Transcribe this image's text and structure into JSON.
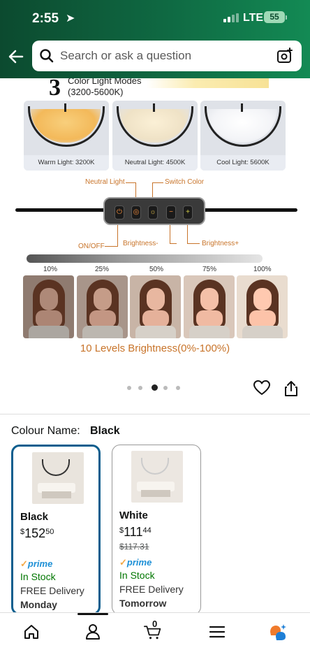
{
  "status_bar": {
    "time": "2:55",
    "network": "LTE",
    "battery": "55"
  },
  "search": {
    "placeholder": "Search or ask a question"
  },
  "hero": {
    "modes_number": "3",
    "modes_title": "Color Light Modes",
    "modes_range": "(3200-5600K)",
    "lamp_cards": [
      {
        "label": "Warm Light: 3200K",
        "glow": "#f6c56a"
      },
      {
        "label": "Neutral Light: 4500K",
        "glow": "#f5e6c2"
      },
      {
        "label": "Cool Light: 5600K",
        "glow": "#ffffff"
      }
    ],
    "controller_labels": {
      "neutral": "Neutral Light",
      "switch": "Switch Color",
      "onoff": "ON/OFF",
      "bminus": "Brightness-",
      "bplus": "Brightness+"
    },
    "percentages": [
      "10%",
      "25%",
      "50%",
      "75%",
      "100%"
    ],
    "caption": "10 Levels Brightness(0%-100%)"
  },
  "carousel": {
    "count": 5,
    "active_index": 2
  },
  "colour": {
    "label": "Colour Name:",
    "value": "Black",
    "options": [
      {
        "name": "Black",
        "currency": "$",
        "price_whole": "152",
        "price_frac": "50",
        "prime": "prime",
        "stock": "In Stock",
        "delivery": "FREE Delivery",
        "when": "Monday",
        "selected": true
      },
      {
        "name": "White",
        "currency": "$",
        "price_whole": "111",
        "price_frac": "44",
        "old_price": "$117.31",
        "prime": "prime",
        "stock": "In Stock",
        "delivery": "FREE Delivery",
        "when": "Tomorrow",
        "selected": false
      }
    ]
  },
  "nav": {
    "cart_count": "0",
    "items": [
      "home-icon",
      "account-icon",
      "cart-icon",
      "menu-icon",
      "rufus-icon"
    ]
  },
  "colors": {
    "header_green": "#0f6a43",
    "prime_blue": "#1e90d6",
    "in_stock": "#007600",
    "selected_border": "#0c5e8e",
    "accent_orange": "#c8742a"
  }
}
